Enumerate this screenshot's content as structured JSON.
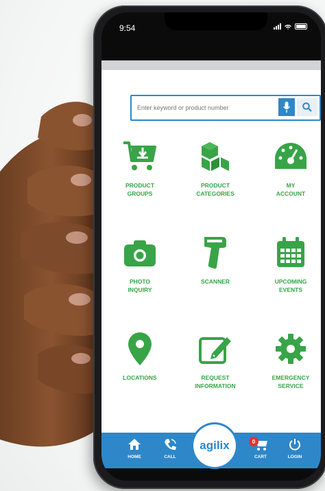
{
  "status": {
    "time": "9:54"
  },
  "search": {
    "placeholder": "Enter keyword or product number"
  },
  "tiles": [
    {
      "label": "PRODUCT\nGROUPS",
      "icon": "cart-download-icon"
    },
    {
      "label": "PRODUCT\nCATEGORIES",
      "icon": "boxes-icon"
    },
    {
      "label": "MY\nACCOUNT",
      "icon": "dashboard-icon"
    },
    {
      "label": "PHOTO\nINQUIRY",
      "icon": "camera-icon"
    },
    {
      "label": "SCANNER",
      "icon": "barcode-scanner-icon"
    },
    {
      "label": "UPCOMING\nEVENTS",
      "icon": "calendar-icon"
    },
    {
      "label": "LOCATIONS",
      "icon": "map-pin-icon"
    },
    {
      "label": "REQUEST\nINFORMATION",
      "icon": "edit-icon"
    },
    {
      "label": "EMERGENCY\nSERVICE",
      "icon": "gear-icon"
    }
  ],
  "nav": {
    "home": "HOME",
    "call": "CALL",
    "logo": "agilix",
    "cart": "CART",
    "cart_count": "0",
    "login": "LOGIN"
  },
  "colors": {
    "green": "#38a447",
    "blue": "#2e87c9",
    "badge": "#e3342f"
  }
}
